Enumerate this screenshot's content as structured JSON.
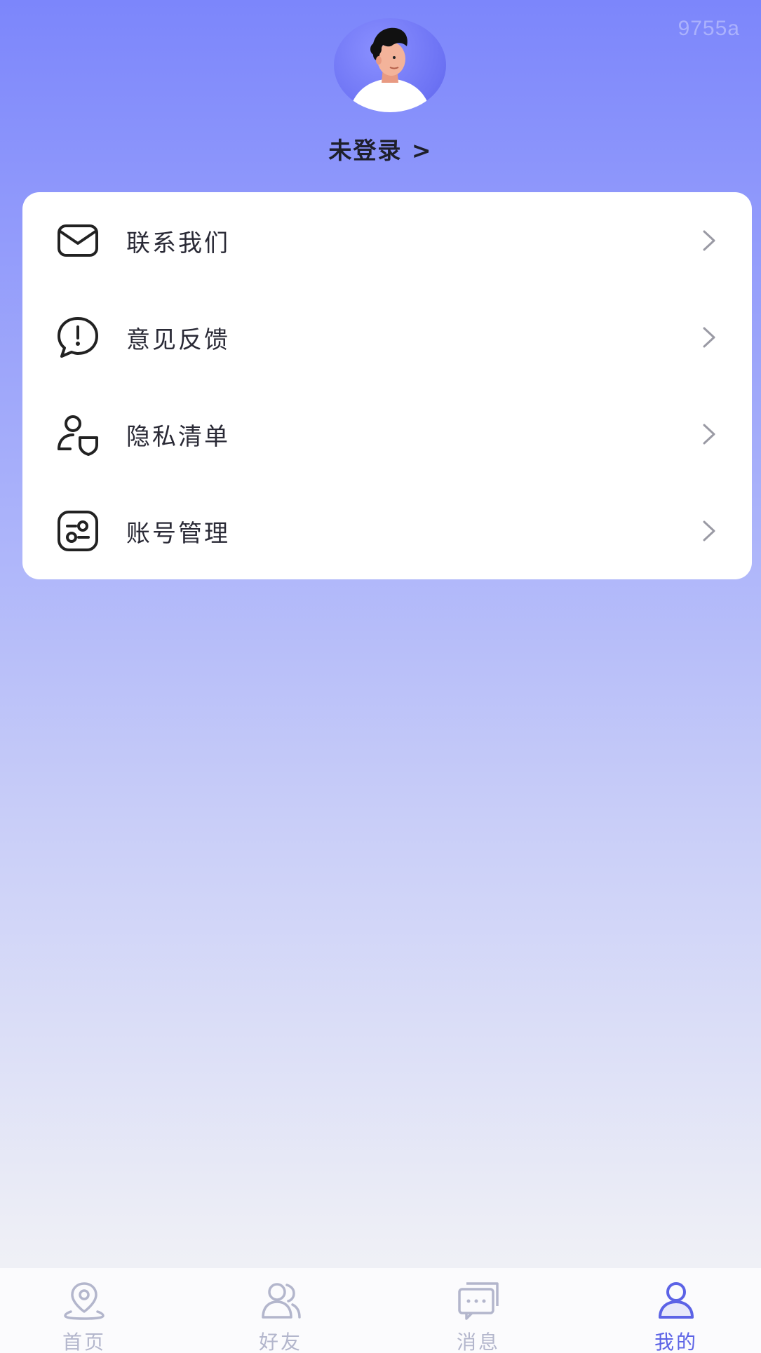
{
  "header": {
    "version": "9755a",
    "login_text": "未登录 >"
  },
  "menu": {
    "items": [
      {
        "icon": "mail-icon",
        "label": "联系我们"
      },
      {
        "icon": "feedback-icon",
        "label": "意见反馈"
      },
      {
        "icon": "privacy-icon",
        "label": "隐私清单"
      },
      {
        "icon": "account-settings-icon",
        "label": "账号管理"
      }
    ]
  },
  "tabbar": {
    "tabs": [
      {
        "icon": "location-icon",
        "label": "首页",
        "active": false
      },
      {
        "icon": "friends-icon",
        "label": "好友",
        "active": false
      },
      {
        "icon": "message-icon",
        "label": "消息",
        "active": false
      },
      {
        "icon": "user-icon",
        "label": "我的",
        "active": true
      }
    ]
  },
  "colors": {
    "accent": "#5c63e6",
    "inactive_tab": "#b3b6cc",
    "gradient_top": "#7c86fb",
    "gradient_bottom": "#f4f4f8"
  }
}
